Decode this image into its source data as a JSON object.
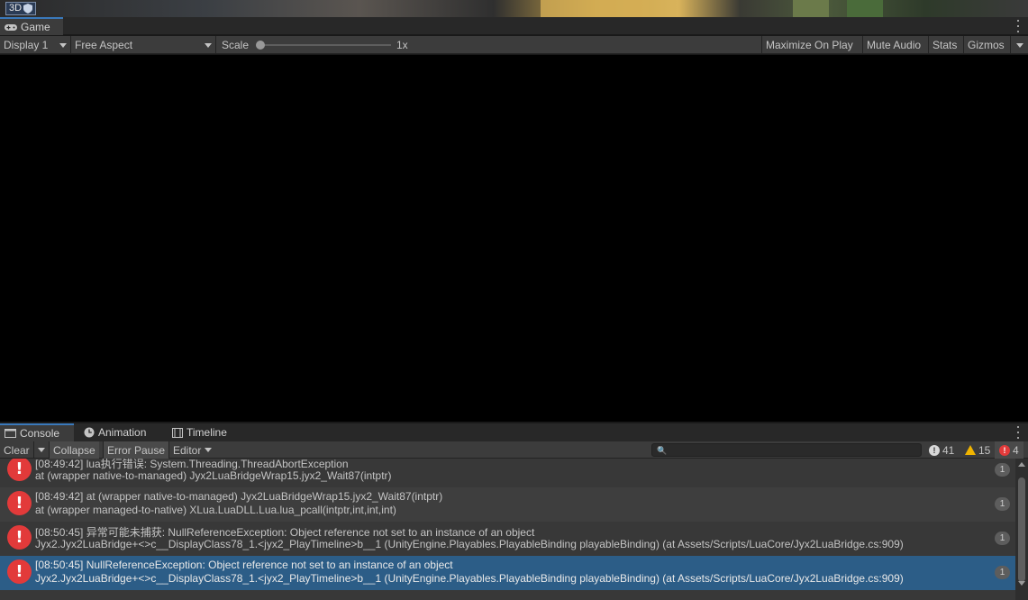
{
  "scene": {
    "badge_label": "3D"
  },
  "game_panel": {
    "tab_label": "Game",
    "toolbar": {
      "display": "Display 1",
      "aspect": "Free Aspect",
      "scale_label": "Scale",
      "scale_value": "1x",
      "maximize": "Maximize On Play",
      "mute": "Mute Audio",
      "stats": "Stats",
      "gizmos": "Gizmos"
    }
  },
  "console_panel": {
    "tabs": [
      "Console",
      "Animation",
      "Timeline"
    ],
    "toolbar": {
      "clear": "Clear",
      "collapse": "Collapse",
      "error_pause": "Error Pause",
      "editor": "Editor",
      "search_value": "",
      "info_count": "41",
      "warning_count": "15",
      "error_count": "4"
    },
    "logs": [
      {
        "line1": "[08:49:42] lua执行错误:   System.Threading.ThreadAbortException",
        "line2": "  at (wrapper native-to-managed) Jyx2LuaBridgeWrap15.jyx2_Wait87(intptr)",
        "count": "1"
      },
      {
        "line1": "[08:49:42]   at (wrapper native-to-managed) Jyx2LuaBridgeWrap15.jyx2_Wait87(intptr)",
        "line2": "  at (wrapper managed-to-native) XLua.LuaDLL.Lua.lua_pcall(intptr,int,int,int)",
        "count": "1"
      },
      {
        "line1": "[08:50:45] 异常可能未捕获: NullReferenceException: Object reference not set to an instance of an object",
        "line2": "Jyx2.Jyx2LuaBridge+<>c__DisplayClass78_1.<jyx2_PlayTimeline>b__1 (UnityEngine.Playables.PlayableBinding playableBinding) (at Assets/Scripts/LuaCore/Jyx2LuaBridge.cs:909)",
        "count": "1"
      },
      {
        "line1": "[08:50:45] NullReferenceException: Object reference not set to an instance of an object",
        "line2": "Jyx2.Jyx2LuaBridge+<>c__DisplayClass78_1.<jyx2_PlayTimeline>b__1 (UnityEngine.Playables.PlayableBinding playableBinding) (at Assets/Scripts/LuaCore/Jyx2LuaBridge.cs:909)",
        "count": "1"
      }
    ]
  }
}
